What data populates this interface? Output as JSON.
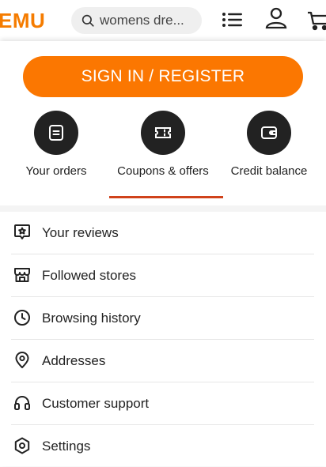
{
  "header": {
    "logo": "EMU",
    "search": {
      "value": "womens dre...",
      "icon": "search-icon"
    },
    "icons": [
      "menu-list-icon",
      "user-icon",
      "cart-icon"
    ]
  },
  "account_panel": {
    "signin_label": "SIGN IN / REGISTER",
    "quick_actions": [
      {
        "label": "Your orders",
        "icon": "orders-icon"
      },
      {
        "label": "Coupons & offers",
        "icon": "coupon-icon",
        "selected": true
      },
      {
        "label": "Credit balance",
        "icon": "wallet-icon"
      }
    ],
    "menu_items": [
      {
        "label": "Your reviews",
        "icon": "review-icon"
      },
      {
        "label": "Followed stores",
        "icon": "store-icon"
      },
      {
        "label": "Browsing history",
        "icon": "clock-icon"
      },
      {
        "label": "Addresses",
        "icon": "location-pin-icon"
      },
      {
        "label": "Customer support",
        "icon": "headphones-icon"
      },
      {
        "label": "Settings",
        "icon": "settings-icon"
      }
    ]
  },
  "colors": {
    "brand_orange": "#fb7701",
    "logo_orange": "#f57c00",
    "selected_underline": "#d0421b",
    "icon_dark": "#222222"
  }
}
